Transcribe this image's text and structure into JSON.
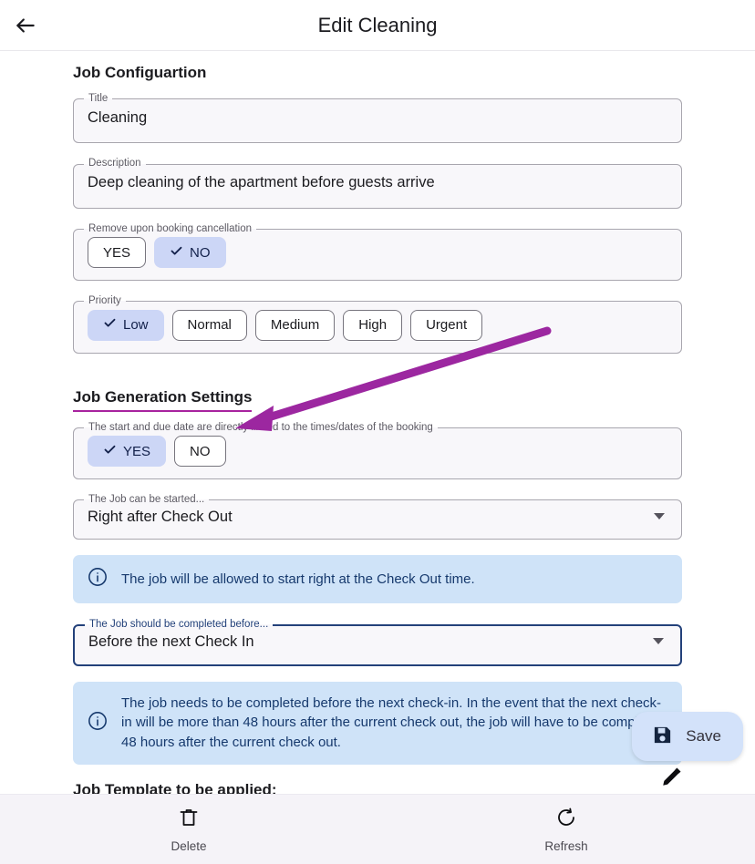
{
  "appbar": {
    "back_icon": "arrow-left-icon",
    "title": "Edit Cleaning"
  },
  "sections": {
    "job_configuration": {
      "heading": "Job Configuartion",
      "title_field": {
        "label": "Title",
        "value": "Cleaning"
      },
      "description_field": {
        "label": "Description",
        "value": "Deep cleaning of the apartment before guests arrive"
      },
      "remove_on_cancel": {
        "label": "Remove upon booking cancellation",
        "options": [
          {
            "label": "YES",
            "selected": false
          },
          {
            "label": "NO",
            "selected": true
          }
        ]
      },
      "priority": {
        "label": "Priority",
        "options": [
          {
            "label": "Low",
            "selected": true
          },
          {
            "label": "Normal",
            "selected": false
          },
          {
            "label": "Medium",
            "selected": false
          },
          {
            "label": "High",
            "selected": false
          },
          {
            "label": "Urgent",
            "selected": false
          }
        ]
      }
    },
    "job_generation_settings": {
      "heading": "Job Generation Settings",
      "linked_dates": {
        "label": "The start and due date are directly linked to the times/dates of the booking",
        "options": [
          {
            "label": "YES",
            "selected": true
          },
          {
            "label": "NO",
            "selected": false
          }
        ]
      },
      "start_select": {
        "label": "The Job can be started...",
        "value": "Right after Check Out",
        "focused": false
      },
      "start_info": {
        "icon": "info-icon",
        "text": "The job will be allowed to start right at the Check Out time."
      },
      "complete_select": {
        "label": "The Job should be completed before...",
        "value": "Before the next Check In",
        "focused": true
      },
      "complete_info": {
        "icon": "info-icon",
        "text": "The job needs to be completed before the next check-in. In the event that the next check-in will be more than 48 hours after the current check out, the job will have to be completed 48 hours after the current check out."
      }
    },
    "job_template": {
      "heading": "Job Template to be applied:"
    }
  },
  "fab": {
    "icon": "save-floppy-icon",
    "label": "Save"
  },
  "pencil": {
    "icon": "pencil-edit-icon"
  },
  "bottombar": {
    "items": [
      {
        "icon": "trash-delete-icon",
        "label": "Delete"
      },
      {
        "icon": "refresh-icon",
        "label": "Refresh"
      }
    ]
  },
  "annotation": {
    "type": "arrow",
    "color": "#9c27a0",
    "points": "from (600,363) to (262,468)",
    "target": "linked-dates-no-option"
  },
  "colors": {
    "accent_underline": "#a8239f",
    "chip_selected_bg": "#ccd6f6",
    "info_bg": "#cfe3f8",
    "info_text": "#16396d",
    "focus_border": "#23417a",
    "fab_bg": "#d3e2fa"
  }
}
